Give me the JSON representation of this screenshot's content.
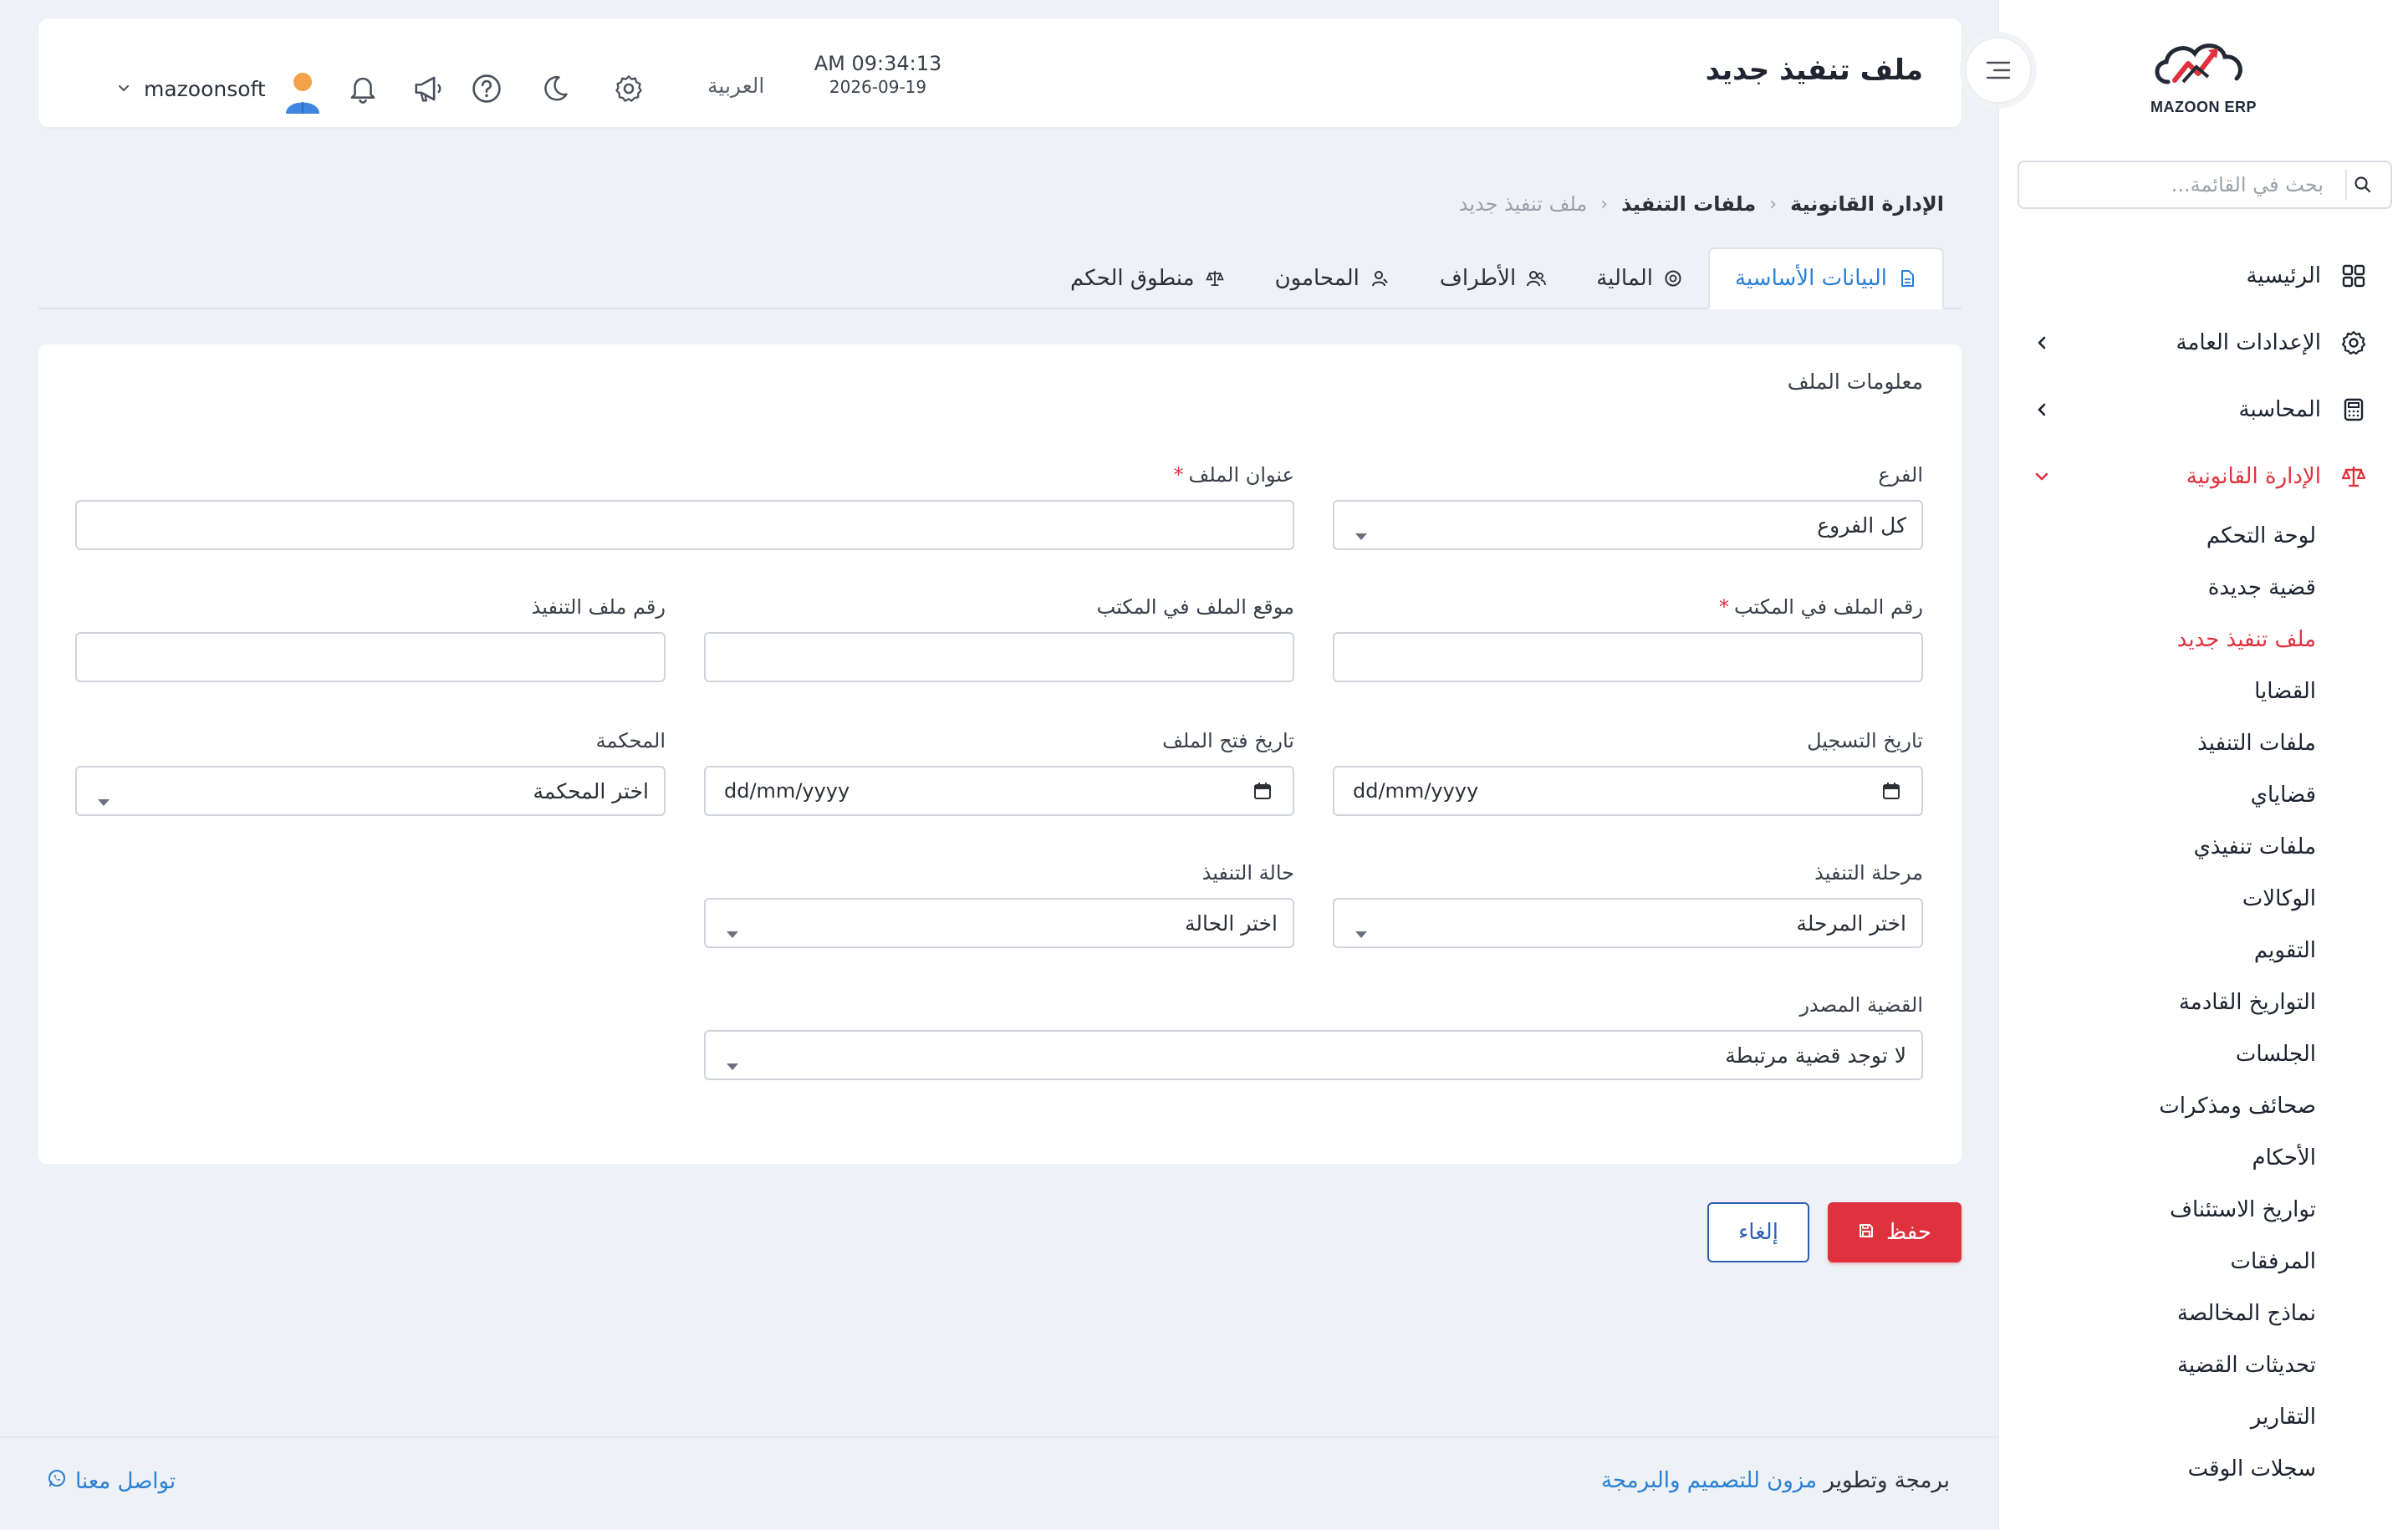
{
  "app": {
    "logo_text": "MAZOON ERP",
    "logo_small": "ERP"
  },
  "sidebar": {
    "search_placeholder": "بحث في القائمة...",
    "items": [
      {
        "label": "الرئيسية",
        "icon": "grid-icon"
      },
      {
        "label": "الإعدادات العامة",
        "icon": "gear-icon"
      },
      {
        "label": "المحاسبة",
        "icon": "calculator-icon"
      },
      {
        "label": "الإدارة القانونية",
        "icon": "scale-icon"
      }
    ],
    "sub_items": [
      "لوحة التحكم",
      "قضية جديدة",
      "ملف تنفيذ جديد",
      "القضايا",
      "ملفات التنفيذ",
      "قضاياي",
      "ملفات تنفيذي",
      "الوكالات",
      "التقويم",
      "التواريخ القادمة",
      "الجلسات",
      "صحائف ومذكرات",
      "الأحكام",
      "تواريخ الاستئناف",
      "المرفقات",
      "نماذج المخالصة",
      "تحديثات القضية",
      "التقارير",
      "سجلات الوقت"
    ],
    "active_sub": "ملف تنفيذ جديد"
  },
  "header": {
    "title": "ملف تنفيذ جديد",
    "time": "AM 09:34:13",
    "date": "2026-09-19",
    "language": "العربية",
    "username": "mazoonsoft"
  },
  "breadcrumb": [
    "الإدارة القانونية",
    "ملفات التنفيذ",
    "ملف تنفيذ جديد"
  ],
  "tabs": [
    {
      "label": "البيانات الأساسية",
      "icon": "document-icon",
      "active": true
    },
    {
      "label": "المالية",
      "icon": "coin-icon"
    },
    {
      "label": "الأطراف",
      "icon": "users-icon"
    },
    {
      "label": "المحامون",
      "icon": "lawyer-icon"
    },
    {
      "label": "منطوق الحكم",
      "icon": "scale-icon"
    }
  ],
  "form": {
    "section_title": "معلومات الملف",
    "branch": {
      "label": "الفرع",
      "value": "كل الفروع"
    },
    "file_title": {
      "label": "عنوان الملف",
      "required": "*",
      "value": ""
    },
    "office_file_no": {
      "label": "رقم الملف في المكتب",
      "required": "*",
      "value": ""
    },
    "office_location": {
      "label": "موقع الملف في المكتب",
      "value": ""
    },
    "execution_file_no": {
      "label": "رقم ملف التنفيذ",
      "value": ""
    },
    "registration_date": {
      "label": "تاريخ التسجيل",
      "placeholder": "dd/mm/yyyy"
    },
    "open_date": {
      "label": "تاريخ فتح الملف",
      "placeholder": "dd/mm/yyyy"
    },
    "court": {
      "label": "المحكمة",
      "value": "اختر المحكمة"
    },
    "stage": {
      "label": "مرحلة التنفيذ",
      "value": "اختر المرحلة"
    },
    "status": {
      "label": "حالة التنفيذ",
      "value": "اختر الحالة"
    },
    "source_case": {
      "label": "القضية المصدر",
      "value": "لا توجد قضية مرتبطة"
    }
  },
  "buttons": {
    "save": "حفظ",
    "cancel": "إلغاء"
  },
  "footer": {
    "credit_prefix": "برمجة وتطوير",
    "credit_link": "مزون للتصميم والبرمجة",
    "contact": "تواصل معنا"
  },
  "colors": {
    "accent_red": "#e0313f",
    "accent_blue": "#2a7fd4",
    "cancel_blue": "#2e5fb4"
  }
}
